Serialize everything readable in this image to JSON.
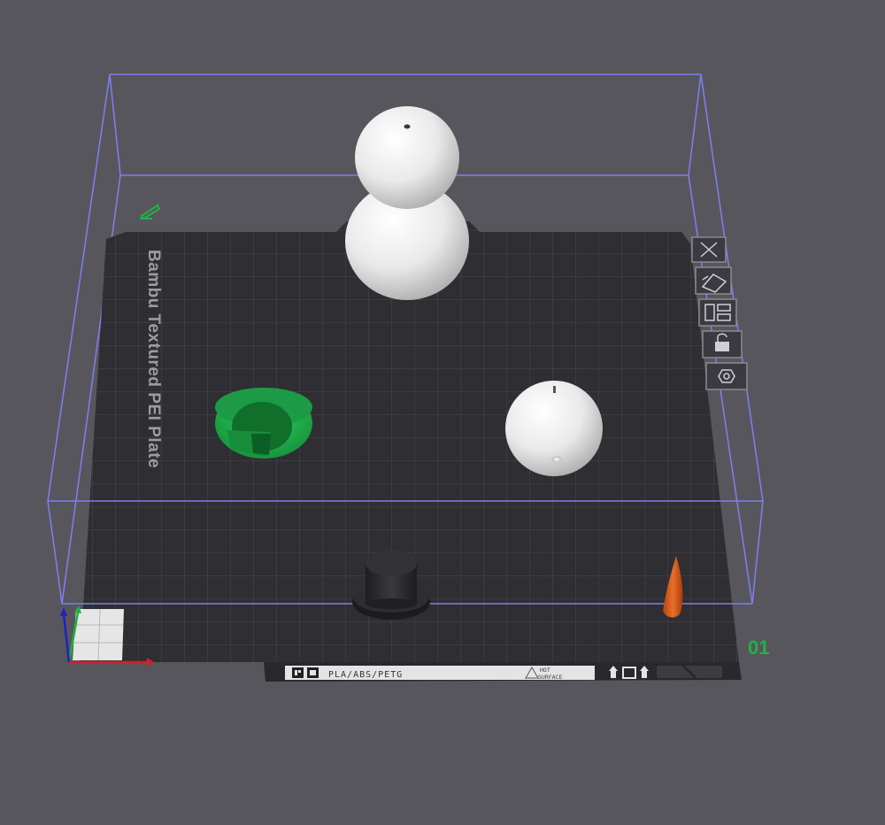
{
  "plate": {
    "brand_text": "Bambu Textured PEI Plate",
    "plate_number": "01",
    "label_strip": {
      "materials": "PLA/ABS/PETG",
      "warning_line1": "HOT",
      "warning_line2": "SURFACE"
    }
  },
  "plate_toolbar": {
    "buttons": [
      {
        "name": "close-plate-button",
        "icon": "close-icon"
      },
      {
        "name": "auto-orient-button",
        "icon": "orient-icon"
      },
      {
        "name": "arrange-button",
        "icon": "arrange-icon"
      },
      {
        "name": "lock-plate-button",
        "icon": "lock-icon"
      },
      {
        "name": "plate-settings-button",
        "icon": "settings-icon"
      }
    ]
  },
  "objects": [
    {
      "name": "snowman-body",
      "color": "#ededed"
    },
    {
      "name": "snowman-head",
      "color": "#ededed"
    },
    {
      "name": "snowman-ball",
      "color": "#ededed"
    },
    {
      "name": "green-scarf-ring",
      "color": "#1fa84a"
    },
    {
      "name": "black-top-hat",
      "color": "#2a2a2c"
    },
    {
      "name": "orange-carrot-nose",
      "color": "#d45a1a"
    }
  ],
  "colors": {
    "background": "#57565d",
    "build_volume": "#7f7ff0",
    "plate": "#2e2e33",
    "accent_green": "#21b04a"
  }
}
